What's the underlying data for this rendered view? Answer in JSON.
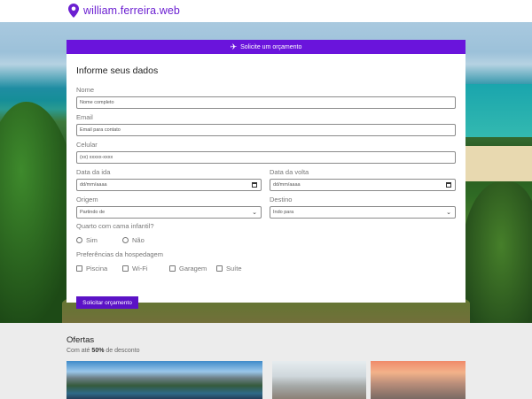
{
  "header": {
    "brand": "william.ferreira.web",
    "icon": "map-pin-icon",
    "accent": "#6b1fd1"
  },
  "form": {
    "banner": "Solicite um orçamento",
    "title": "Informe seus dados",
    "nome": {
      "label": "Nome",
      "placeholder": "Nome completo"
    },
    "email": {
      "label": "Email",
      "placeholder": "Email para contato"
    },
    "celular": {
      "label": "Celular",
      "placeholder": "(xx) xxxxx-xxxx"
    },
    "data_ida": {
      "label": "Data da ida",
      "value": "dd/mm/aaaa"
    },
    "data_volta": {
      "label": "Data da volta",
      "value": "dd/mm/aaaa"
    },
    "origem": {
      "label": "Origem",
      "value": "Partindo de"
    },
    "destino": {
      "label": "Destino",
      "value": "Indo para"
    },
    "quarto": {
      "label": "Quarto com cama infantil?",
      "options": [
        "Sim",
        "Não"
      ]
    },
    "preferencias": {
      "label": "Preferências da hospedagem",
      "options": [
        "Piscina",
        "Wi-Fi",
        "Garagem",
        "Suíte"
      ]
    },
    "submit": "Solicitar orçamento",
    "button_color": "#5b12c6"
  },
  "offers": {
    "title": "Ofertas",
    "subtitle_prefix": "Com até",
    "subtitle_bold": "50%",
    "subtitle_suffix": "de desconto"
  }
}
